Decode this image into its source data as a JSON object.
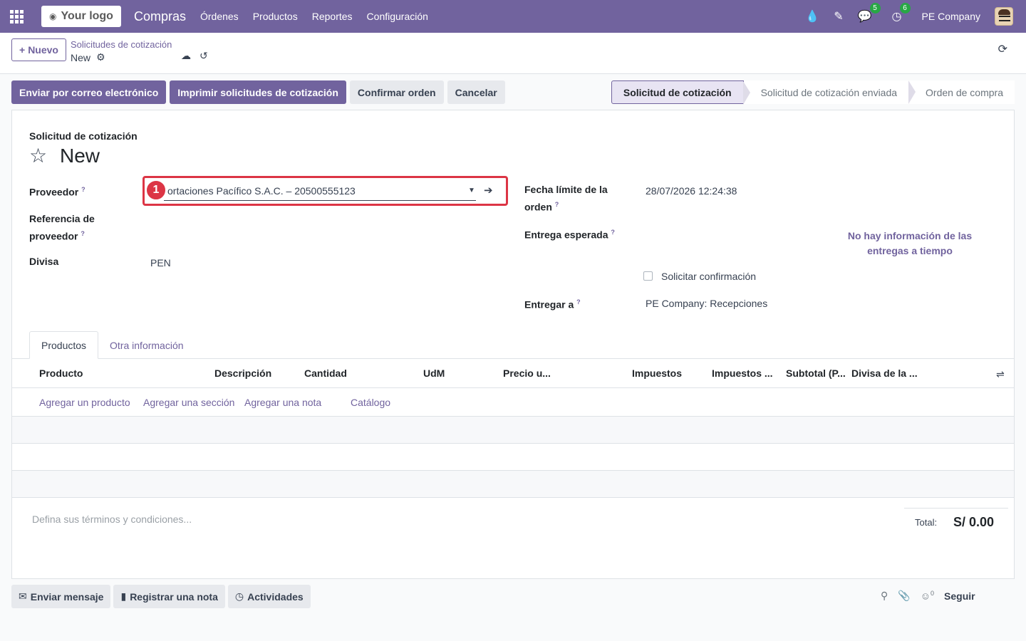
{
  "navbar": {
    "logo": "Your logo",
    "app": "Compras",
    "menu": [
      "Órdenes",
      "Productos",
      "Reportes",
      "Configuración"
    ],
    "messages_count": "5",
    "activities_count": "6",
    "company": "PE Company"
  },
  "breadcrumb": {
    "new_button": "Nuevo",
    "parent": "Solicitudes de cotización",
    "current": "New"
  },
  "actions": {
    "send_email": "Enviar por correo electrónico",
    "print_rfq": "Imprimir solicitudes de cotización",
    "confirm_order": "Confirmar orden",
    "cancel": "Cancelar"
  },
  "statusbar": {
    "stages": [
      "Solicitud de cotización",
      "Solicitud de cotización enviada",
      "Orden de compra"
    ],
    "active": "Solicitud de cotización"
  },
  "form": {
    "type_label": "Solicitud de cotización",
    "name": "New",
    "vendor_label": "Proveedor",
    "vendor_value": "ortaciones Pacífico S.A.C. – 20500555123",
    "vendor_ref_label_1": "Referencia de",
    "vendor_ref_label_2": "proveedor",
    "currency_label": "Divisa",
    "currency_value": "PEN",
    "deadline_label_1": "Fecha límite de la",
    "deadline_label_2": "orden",
    "deadline_value": "28/07/2026 12:24:38",
    "expected_label": "Entrega esperada",
    "ontime_1": "No hay información de las",
    "ontime_2": "entregas a tiempo",
    "ask_confirm_label": "Solicitar confirmación",
    "deliver_to_label": "Entregar a",
    "deliver_to_value": "PE Company: Recepciones",
    "step_number": "1",
    "help_mark": "?"
  },
  "tabs": [
    "Productos",
    "Otra información"
  ],
  "lines": {
    "columns": [
      "Producto",
      "Descripción",
      "Cantidad",
      "UdM",
      "Precio u...",
      "Impuestos",
      "Impuestos ...",
      "Subtotal (P...",
      "Divisa de la ..."
    ],
    "add_product": "Agregar un producto",
    "add_section": "Agregar una sección",
    "add_note": "Agregar una nota",
    "catalog": "Catálogo"
  },
  "footer": {
    "terms_placeholder": "Defina sus términos y condiciones...",
    "total_label": "Total:",
    "total_value": "S/ 0.00"
  },
  "chatter": {
    "send_message": "Enviar mensaje",
    "log_note": "Registrar una nota",
    "activities": "Actividades",
    "followers_count": "0",
    "follow": "Seguir"
  }
}
